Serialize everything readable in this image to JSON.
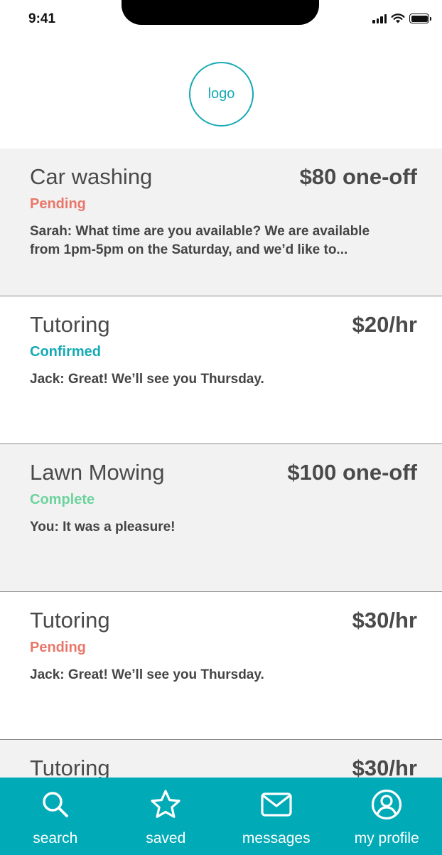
{
  "status_bar": {
    "time": "9:41"
  },
  "logo": {
    "text": "logo"
  },
  "cards": [
    {
      "title": "Car washing",
      "price": "$80 one-off",
      "status": "Pending",
      "message": "Sarah: What time are you available? We are available from 1pm-5pm on the Saturday, and we’d like to..."
    },
    {
      "title": "Tutoring",
      "price": "$20/hr",
      "status": "Confirmed",
      "message": "Jack: Great! We’ll see you Thursday."
    },
    {
      "title": "Lawn Mowing",
      "price": "$100 one-off",
      "status": "Complete",
      "message": "You: It was a pleasure!"
    },
    {
      "title": "Tutoring",
      "price": "$30/hr",
      "status": "Pending",
      "message": "Jack: Great! We’ll see you Thursday."
    },
    {
      "title": "Tutoring",
      "price": "$30/hr",
      "status": "",
      "message": ""
    }
  ],
  "tab_bar": {
    "tabs": [
      {
        "label": "search",
        "icon": "search-icon"
      },
      {
        "label": "saved",
        "icon": "star-icon"
      },
      {
        "label": "messages",
        "icon": "envelope-icon"
      },
      {
        "label": "my profile",
        "icon": "user-circle-icon"
      }
    ]
  },
  "colors": {
    "accent": "#00aab7",
    "pending": "#e8776a",
    "confirmed": "#16a9b6",
    "complete": "#6dd39d"
  }
}
